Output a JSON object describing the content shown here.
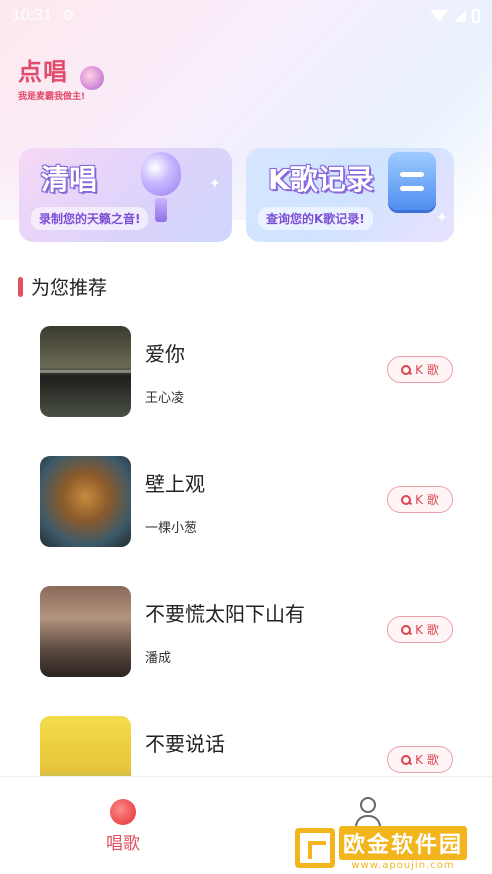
{
  "status_bar": {
    "time": "10:31"
  },
  "app": {
    "logo_title": "点唱",
    "logo_slogan": "我是麦霸我做主!"
  },
  "banners": [
    {
      "title": "清唱",
      "subtitle": "录制您的天籁之音!"
    },
    {
      "title": "K歌记录",
      "subtitle": "查询您的K歌记录!"
    }
  ],
  "section": {
    "title": "为您推荐"
  },
  "songs": [
    {
      "name": "爱你",
      "artist": "王心凌",
      "button": "K 歌"
    },
    {
      "name": "壁上观",
      "artist": "一棵小葱",
      "button": "K 歌"
    },
    {
      "name": "不要慌太阳下山有",
      "artist": "潘成",
      "button": "K 歌"
    },
    {
      "name": "不要说话",
      "artist": "",
      "button": "K 歌"
    }
  ],
  "bottom_nav": {
    "sing_label": "唱歌"
  },
  "watermark": {
    "title": "欧金软件园",
    "url": "www.apoujin.com"
  },
  "colors": {
    "accent": "#e2505f",
    "button_border": "#e9a0a8",
    "watermark": "#f2b51d"
  }
}
